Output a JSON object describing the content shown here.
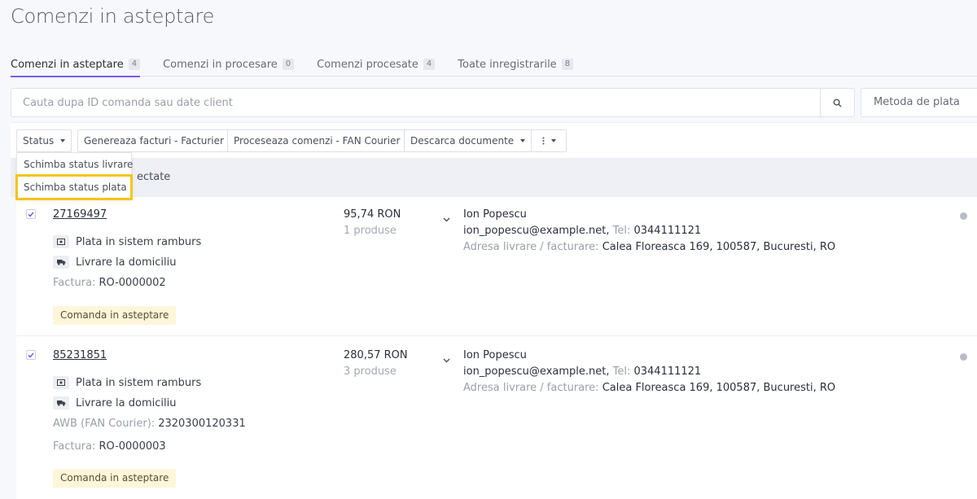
{
  "page": {
    "title": "Comenzi in asteptare"
  },
  "tabs": [
    {
      "label": "Comenzi in asteptare",
      "count": "4"
    },
    {
      "label": "Comenzi in procesare",
      "count": "0"
    },
    {
      "label": "Comenzi procesate",
      "count": "4"
    },
    {
      "label": "Toate inregistrarile",
      "count": "8"
    }
  ],
  "search": {
    "placeholder": "Cauta dupa ID comanda sau date client",
    "payment_filter": "Metoda de plata"
  },
  "toolbar": {
    "status": "Status",
    "invoice": "Genereaza facturi - Facturier",
    "process": "Proceseaza comenzi - FAN Courier",
    "download": "Descarca documente"
  },
  "dropdown": {
    "items": [
      "Schimba status livrare",
      "Schimba status plata"
    ]
  },
  "selection": {
    "text": "ectate"
  },
  "orders": [
    {
      "id": "27169497",
      "amount": "95,74 RON",
      "products": "1 produse",
      "payment": "Plata in sistem ramburs",
      "delivery": "Livrare la domiciliu",
      "awb_label": "",
      "awb_value": "",
      "invoice_label": "Factura:",
      "invoice_value": "RO-0000002",
      "status": "Comanda in asteptare",
      "client_name": "Ion Popescu",
      "email": "ion_popescu@example.net",
      "tel_label": "Tel:",
      "tel": "0344111121",
      "address_label": "Adresa livrare / facturare:",
      "address": "Calea Floreasca 169, 100587, Bucuresti, RO"
    },
    {
      "id": "85231851",
      "amount": "280,57 RON",
      "products": "3 produse",
      "payment": "Plata in sistem ramburs",
      "delivery": "Livrare la domiciliu",
      "awb_label": "AWB (FAN Courier):",
      "awb_value": "2320300120331",
      "invoice_label": "Factura:",
      "invoice_value": "RO-0000003",
      "status": "Comanda in asteptare",
      "client_name": "Ion Popescu",
      "email": "ion_popescu@example.net",
      "tel_label": "Tel:",
      "tel": "0344111121",
      "address_label": "Adresa livrare / facturare:",
      "address": "Calea Floreasca 169, 100587, Bucuresti, RO"
    }
  ],
  "colors": {
    "accent": "#7a5cf0",
    "highlight": "#f5c518",
    "badge_bg": "#fdf6da"
  }
}
